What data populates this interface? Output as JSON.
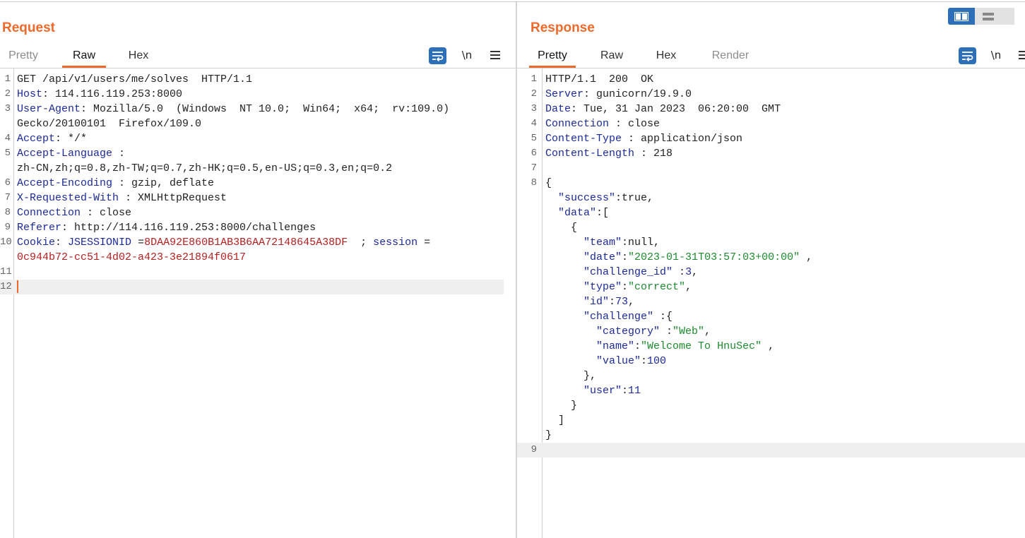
{
  "request": {
    "title": "Request",
    "tabs": [
      {
        "label": "Pretty",
        "state": "dim"
      },
      {
        "label": "Raw",
        "state": "active"
      },
      {
        "label": "Hex",
        "state": "normal"
      }
    ],
    "newline_label": "\\n",
    "lines": [
      {
        "n": "1",
        "parts": [
          {
            "t": "GET /api/v1/users/me/solves  HTTP/1.1",
            "c": "hv"
          }
        ]
      },
      {
        "n": "2",
        "parts": [
          {
            "t": "Host",
            "c": "hk"
          },
          {
            "t": ": 114.116.119.253:8000",
            "c": "hv"
          }
        ]
      },
      {
        "n": "3",
        "parts": [
          {
            "t": "User-Agent",
            "c": "hk"
          },
          {
            "t": ": Mozilla/5.0  (Windows  NT 10.0;  Win64;  x64;  rv:109.0)",
            "c": "hv"
          }
        ]
      },
      {
        "n": "",
        "parts": [
          {
            "t": "Gecko/20100101  Firefox/109.0",
            "c": "hv"
          }
        ]
      },
      {
        "n": "4",
        "parts": [
          {
            "t": "Accept",
            "c": "hk"
          },
          {
            "t": ": */*",
            "c": "hv"
          }
        ]
      },
      {
        "n": "5",
        "parts": [
          {
            "t": "Accept-Language",
            "c": "hk"
          },
          {
            "t": " :",
            "c": "hv"
          }
        ]
      },
      {
        "n": "",
        "parts": [
          {
            "t": "zh-CN,zh;q=0.8,zh-TW;q=0.7,zh-HK;q=0.5,en-US;q=0.3,en;q=0.2",
            "c": "hv"
          }
        ]
      },
      {
        "n": "6",
        "parts": [
          {
            "t": "Accept-Encoding",
            "c": "hk"
          },
          {
            "t": " : gzip, deflate",
            "c": "hv"
          }
        ]
      },
      {
        "n": "7",
        "parts": [
          {
            "t": "X-Requested-With",
            "c": "hk"
          },
          {
            "t": " : XMLHttpRequest",
            "c": "hv"
          }
        ]
      },
      {
        "n": "8",
        "parts": [
          {
            "t": "Connection",
            "c": "hk"
          },
          {
            "t": " : close",
            "c": "hv"
          }
        ]
      },
      {
        "n": "9",
        "parts": [
          {
            "t": "Referer",
            "c": "hk"
          },
          {
            "t": ": http://114.116.119.253:8000/challenges",
            "c": "hv"
          }
        ]
      },
      {
        "n": "10",
        "parts": [
          {
            "t": "Cookie",
            "c": "hk"
          },
          {
            "t": ": ",
            "c": "hv"
          },
          {
            "t": "JSESSIONID",
            "c": "ck"
          },
          {
            "t": " =",
            "c": "hv"
          },
          {
            "t": "8DAA92E860B1AB3B6AA72148645A38DF",
            "c": "cv"
          },
          {
            "t": "  ; ",
            "c": "hv"
          },
          {
            "t": "session",
            "c": "ck"
          },
          {
            "t": " =",
            "c": "hv"
          }
        ]
      },
      {
        "n": "",
        "parts": [
          {
            "t": "0c944b72-cc51-4d02-a423-3e21894f0617",
            "c": "cv"
          }
        ]
      },
      {
        "n": "11",
        "parts": []
      },
      {
        "n": "12",
        "parts": [],
        "current": true,
        "caret": true
      }
    ]
  },
  "response": {
    "title": "Response",
    "tabs": [
      {
        "label": "Pretty",
        "state": "active"
      },
      {
        "label": "Raw",
        "state": "normal"
      },
      {
        "label": "Hex",
        "state": "normal"
      },
      {
        "label": "Render",
        "state": "dim"
      }
    ],
    "newline_label": "\\n",
    "lines": [
      {
        "n": "1",
        "parts": [
          {
            "t": "HTTP/1.1  200  OK",
            "c": "hv"
          }
        ]
      },
      {
        "n": "2",
        "parts": [
          {
            "t": "Server",
            "c": "hk"
          },
          {
            "t": ": gunicorn/19.9.0",
            "c": "hv"
          }
        ]
      },
      {
        "n": "3",
        "parts": [
          {
            "t": "Date",
            "c": "hk"
          },
          {
            "t": ": Tue, 31 Jan 2023  06:20:00  GMT",
            "c": "hv"
          }
        ]
      },
      {
        "n": "4",
        "parts": [
          {
            "t": "Connection",
            "c": "hk"
          },
          {
            "t": " : close",
            "c": "hv"
          }
        ]
      },
      {
        "n": "5",
        "parts": [
          {
            "t": "Content-Type",
            "c": "hk"
          },
          {
            "t": " : application/json",
            "c": "hv"
          }
        ]
      },
      {
        "n": "6",
        "parts": [
          {
            "t": "Content-Length",
            "c": "hk"
          },
          {
            "t": " : 218",
            "c": "hv"
          }
        ]
      },
      {
        "n": "7",
        "parts": []
      },
      {
        "n": "8",
        "parts": [
          {
            "t": "{",
            "c": "jp"
          }
        ]
      },
      {
        "n": "",
        "parts": [
          {
            "t": "  ",
            "c": "jp"
          },
          {
            "t": "\"success\"",
            "c": "jk"
          },
          {
            "t": ":true,",
            "c": "jp"
          }
        ]
      },
      {
        "n": "",
        "parts": [
          {
            "t": "  ",
            "c": "jp"
          },
          {
            "t": "\"data\"",
            "c": "jk"
          },
          {
            "t": ":[",
            "c": "jp"
          }
        ]
      },
      {
        "n": "",
        "parts": [
          {
            "t": "    {",
            "c": "jp"
          }
        ]
      },
      {
        "n": "",
        "parts": [
          {
            "t": "      ",
            "c": "jp"
          },
          {
            "t": "\"team\"",
            "c": "jk"
          },
          {
            "t": ":null,",
            "c": "jp"
          }
        ]
      },
      {
        "n": "",
        "parts": [
          {
            "t": "      ",
            "c": "jp"
          },
          {
            "t": "\"date\"",
            "c": "jk"
          },
          {
            "t": ":",
            "c": "jp"
          },
          {
            "t": "\"2023-01-31T03:57:03+00:00\"",
            "c": "js"
          },
          {
            "t": " ,",
            "c": "jp"
          }
        ]
      },
      {
        "n": "",
        "parts": [
          {
            "t": "      ",
            "c": "jp"
          },
          {
            "t": "\"challenge_id\"",
            "c": "jk"
          },
          {
            "t": " :",
            "c": "jp"
          },
          {
            "t": "3",
            "c": "jn"
          },
          {
            "t": ",",
            "c": "jp"
          }
        ]
      },
      {
        "n": "",
        "parts": [
          {
            "t": "      ",
            "c": "jp"
          },
          {
            "t": "\"type\"",
            "c": "jk"
          },
          {
            "t": ":",
            "c": "jp"
          },
          {
            "t": "\"correct\"",
            "c": "js"
          },
          {
            "t": ",",
            "c": "jp"
          }
        ]
      },
      {
        "n": "",
        "parts": [
          {
            "t": "      ",
            "c": "jp"
          },
          {
            "t": "\"id\"",
            "c": "jk"
          },
          {
            "t": ":",
            "c": "jp"
          },
          {
            "t": "73",
            "c": "jn"
          },
          {
            "t": ",",
            "c": "jp"
          }
        ]
      },
      {
        "n": "",
        "parts": [
          {
            "t": "      ",
            "c": "jp"
          },
          {
            "t": "\"challenge\"",
            "c": "jk"
          },
          {
            "t": " :{",
            "c": "jp"
          }
        ]
      },
      {
        "n": "",
        "parts": [
          {
            "t": "        ",
            "c": "jp"
          },
          {
            "t": "\"category\"",
            "c": "jk"
          },
          {
            "t": " :",
            "c": "jp"
          },
          {
            "t": "\"Web\"",
            "c": "js"
          },
          {
            "t": ",",
            "c": "jp"
          }
        ]
      },
      {
        "n": "",
        "parts": [
          {
            "t": "        ",
            "c": "jp"
          },
          {
            "t": "\"name\"",
            "c": "jk"
          },
          {
            "t": ":",
            "c": "jp"
          },
          {
            "t": "\"Welcome To HnuSec\"",
            "c": "js"
          },
          {
            "t": " ,",
            "c": "jp"
          }
        ]
      },
      {
        "n": "",
        "parts": [
          {
            "t": "        ",
            "c": "jp"
          },
          {
            "t": "\"value\"",
            "c": "jk"
          },
          {
            "t": ":",
            "c": "jp"
          },
          {
            "t": "100",
            "c": "jn"
          }
        ]
      },
      {
        "n": "",
        "parts": [
          {
            "t": "      },",
            "c": "jp"
          }
        ]
      },
      {
        "n": "",
        "parts": [
          {
            "t": "      ",
            "c": "jp"
          },
          {
            "t": "\"user\"",
            "c": "jk"
          },
          {
            "t": ":",
            "c": "jp"
          },
          {
            "t": "11",
            "c": "jn"
          }
        ]
      },
      {
        "n": "",
        "parts": [
          {
            "t": "    }",
            "c": "jp"
          }
        ]
      },
      {
        "n": "",
        "parts": [
          {
            "t": "  ]",
            "c": "jp"
          }
        ]
      },
      {
        "n": "",
        "parts": [
          {
            "t": "}",
            "c": "jp"
          }
        ]
      },
      {
        "n": "9",
        "parts": [],
        "current": true
      }
    ]
  },
  "colors": {
    "accent": "#ec6a2c",
    "toolbar_blue": "#2d6fb8",
    "header_key": "#1c2a99",
    "cookie_value": "#b42020",
    "json_string": "#1e8a2e"
  },
  "icons": {
    "wrap": "word-wrap-icon",
    "menu": "menu-icon",
    "layout_split": "split-columns-icon",
    "layout_rows": "split-rows-icon"
  }
}
